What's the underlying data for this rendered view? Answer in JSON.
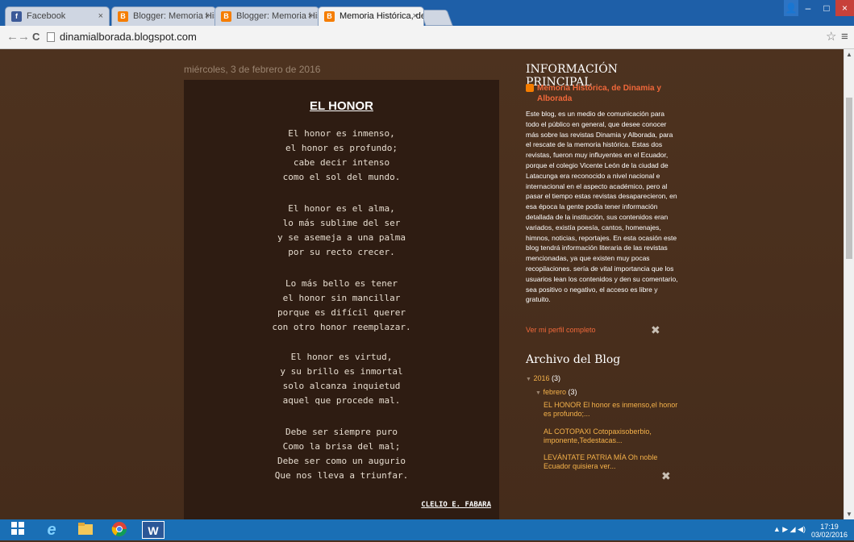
{
  "browser": {
    "tabs": [
      {
        "label": "Facebook",
        "favicon": "facebook-icon",
        "active": false
      },
      {
        "label": "Blogger: Memoria Históric",
        "favicon": "blogger-icon",
        "active": false
      },
      {
        "label": "Blogger: Memoria Históric",
        "favicon": "blogger-icon",
        "active": false
      },
      {
        "label": "Memoria Histórica, de Din",
        "favicon": "blogger-icon",
        "active": true
      }
    ],
    "close_glyph": "×",
    "url": "dinamialborada.blogspot.com",
    "back_glyph": "←",
    "forward_glyph": "→",
    "reload_glyph": "C",
    "star_glyph": "☆",
    "menu_glyph": "≡",
    "window_buttons": {
      "user": "👤",
      "minimize": "–",
      "maximize": "□",
      "close": "×"
    }
  },
  "post": {
    "date": "miércoles, 3 de febrero de 2016",
    "title": "EL HONOR",
    "stanzas": [
      [
        "El honor es inmenso,",
        "el honor es profundo;",
        "cabe decir intenso",
        "como el sol del mundo."
      ],
      [
        "El honor es el alma,",
        "lo más sublime del ser",
        "y se asemeja a una palma",
        "por su recto crecer."
      ],
      [
        "Lo más bello es tener",
        "el honor sin mancillar",
        "porque es difícil querer",
        "con otro honor reemplazar."
      ],
      [
        "El honor es virtud,",
        "y su brillo es inmortal",
        "solo alcanza inquietud",
        "aquel que procede mal."
      ],
      [
        "Debe ser siempre puro",
        "Como la brisa del mal;",
        "Debe ser como un augurio",
        "Que nos lleva a triunfar."
      ]
    ],
    "author": "CLELIO E. FABARA"
  },
  "sidebar": {
    "info_heading": "INFORMACIÓN PRINCIPAL",
    "blog_name": "Memoria Histórica, de Dinamia y Alborada",
    "description": "Este blog, es un medio de comunicación para todo el público en general, que desee conocer más sobre las revistas Dinamia y Alborada, para el rescate de la memoria histórica. Estas dos revistas, fueron muy influyentes en el Ecuador, porque el colegio Vicente León de la ciudad de Latacunga era reconocido a nivel nacional e internacional en el aspecto académico, pero al pasar el tiempo estas revistas desaparecieron, en esa época la gente podía tener información detallada de la institución, sus contenidos eran variados, existía poesía, cantos, homenajes, himnos, noticias, reportajes. En esta ocasión este blog tendrá información literaria de las revistas mencionadas, ya que existen muy pocas recopilaciones. sería de vital importancia que los usuarios lean los contenidos y den su comentario, sea positivo o negativo, el acceso es libre y gratuito.",
    "profile_link": "Ver mi perfil completo",
    "archive_heading": "Archivo del Blog",
    "archive": {
      "year": "2016",
      "year_count": "(3)",
      "month": "febrero",
      "month_count": "(3)",
      "arrow": "▼",
      "posts": [
        "EL HONOR El honor es inmenso,el honor es profundo;...",
        "AL COTOPAXI Cotopaxisoberbio, imponente,Tedestacas...",
        "LEVÁNTATE PATRIA MÍA Oh noble Ecuador quisiera ver..."
      ]
    },
    "tool_glyph": "✖"
  },
  "taskbar": {
    "time": "17:19",
    "date": "03/02/2016",
    "tray": "▲ ▶ ◢ ◀)",
    "apps": [
      "windows-start-icon",
      "internet-explorer-icon",
      "file-explorer-icon",
      "chrome-icon",
      "word-icon"
    ]
  },
  "colors": {
    "page_bg": "#4a2f1f",
    "post_bg": "#2e1c12",
    "link": "#f0683a",
    "archive_link": "#f5b24a",
    "taskbar": "#1a6fb5"
  }
}
